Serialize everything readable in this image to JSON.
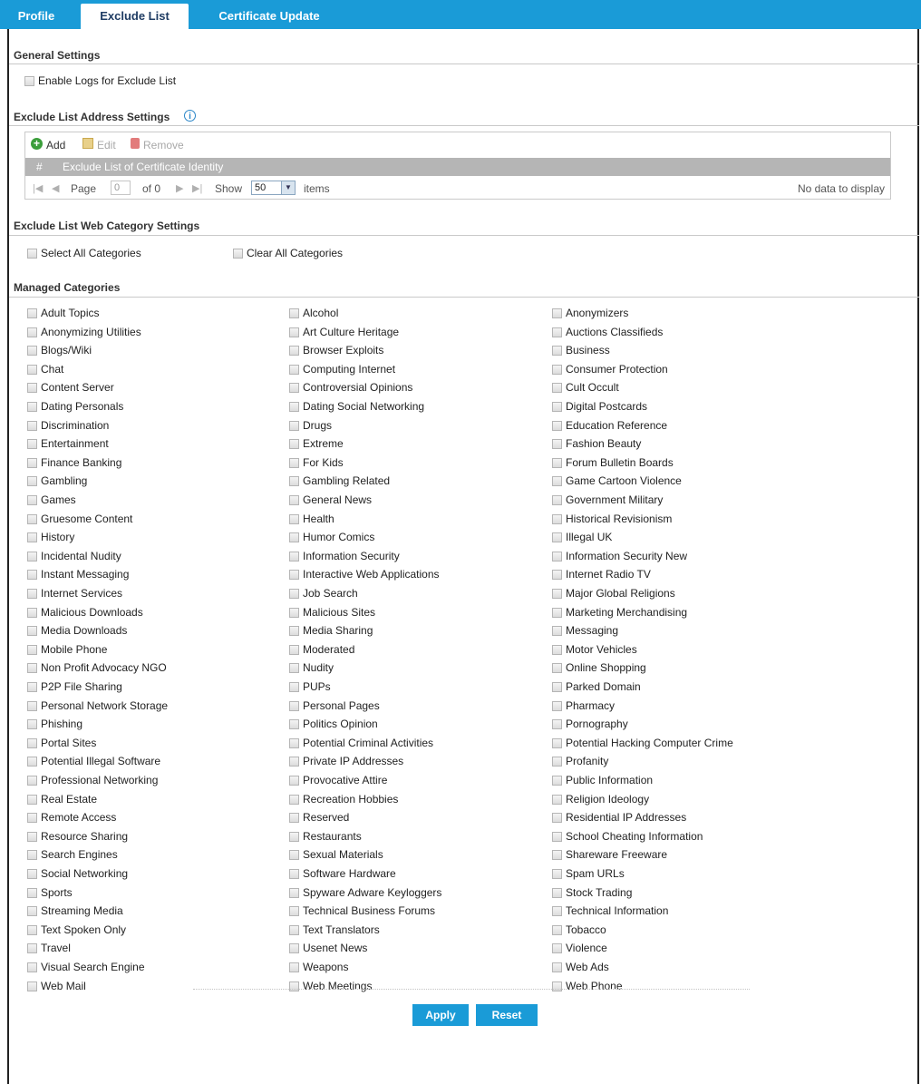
{
  "tabs": [
    {
      "label": "Profile",
      "active": false
    },
    {
      "label": "Exclude List",
      "active": true
    },
    {
      "label": "Certificate Update",
      "active": false
    }
  ],
  "general": {
    "title": "General Settings",
    "enable_logs_label": "Enable Logs for Exclude List"
  },
  "address": {
    "title": "Exclude List Address Settings",
    "info_glyph": "i",
    "toolbar": {
      "add": "Add",
      "edit": "Edit",
      "remove": "Remove"
    },
    "columns": {
      "index": "#",
      "identity": "Exclude List of Certificate Identity"
    },
    "pager": {
      "page_label": "Page",
      "page_value": "0",
      "of_label": "of 0",
      "show_label": "Show",
      "show_value": "50",
      "items_label": "items",
      "no_data": "No data to display"
    }
  },
  "web_category": {
    "title": "Exclude List Web Category Settings",
    "select_all": "Select All Categories",
    "clear_all": "Clear All Categories"
  },
  "managed": {
    "title": "Managed Categories",
    "col1": [
      "Adult Topics",
      "Anonymizing Utilities",
      "Blogs/Wiki",
      "Chat",
      "Content Server",
      "Dating Personals",
      "Discrimination",
      "Entertainment",
      "Finance Banking",
      "Gambling",
      "Games",
      "Gruesome Content",
      "History",
      "Incidental Nudity",
      "Instant Messaging",
      "Internet Services",
      "Malicious Downloads",
      "Media Downloads",
      "Mobile Phone",
      "Non Profit Advocacy NGO",
      "P2P File Sharing",
      "Personal Network Storage",
      "Phishing",
      "Portal Sites",
      "Potential Illegal Software",
      "Professional Networking",
      "Real Estate",
      "Remote Access",
      "Resource Sharing",
      "Search Engines",
      "Social Networking",
      "Sports",
      "Streaming Media",
      "Text Spoken Only",
      "Travel",
      "Visual Search Engine",
      "Web Mail"
    ],
    "col2": [
      "Alcohol",
      "Art Culture Heritage",
      "Browser Exploits",
      "Computing Internet",
      "Controversial Opinions",
      "Dating Social Networking",
      "Drugs",
      "Extreme",
      "For Kids",
      "Gambling Related",
      "General News",
      "Health",
      "Humor Comics",
      "Information Security",
      "Interactive Web Applications",
      "Job Search",
      "Malicious Sites",
      "Media Sharing",
      "Moderated",
      "Nudity",
      "PUPs",
      "Personal Pages",
      "Politics Opinion",
      "Potential Criminal Activities",
      "Private IP Addresses",
      "Provocative Attire",
      "Recreation Hobbies",
      "Reserved",
      "Restaurants",
      "Sexual Materials",
      "Software Hardware",
      "Spyware Adware Keyloggers",
      "Technical Business Forums",
      "Text Translators",
      "Usenet News",
      "Weapons",
      "Web Meetings"
    ],
    "col3": [
      "Anonymizers",
      "Auctions Classifieds",
      "Business",
      "Consumer Protection",
      "Cult Occult",
      "Digital Postcards",
      "Education Reference",
      "Fashion Beauty",
      "Forum Bulletin Boards",
      "Game Cartoon Violence",
      "Government Military",
      "Historical Revisionism",
      "Illegal UK",
      "Information Security New",
      "Internet Radio TV",
      "Major Global Religions",
      "Marketing Merchandising",
      "Messaging",
      "Motor Vehicles",
      "Online Shopping",
      "Parked Domain",
      "Pharmacy",
      "Pornography",
      "Potential Hacking Computer Crime",
      "Profanity",
      "Public Information",
      "Religion Ideology",
      "Residential IP Addresses",
      "School Cheating Information",
      "Shareware Freeware",
      "Spam URLs",
      "Stock Trading",
      "Technical Information",
      "Tobacco",
      "Violence",
      "Web Ads",
      "Web Phone"
    ]
  },
  "buttons": {
    "apply": "Apply",
    "reset": "Reset"
  },
  "colors": {
    "accent": "#1a9bd7",
    "header_gray": "#b5b5b5"
  }
}
